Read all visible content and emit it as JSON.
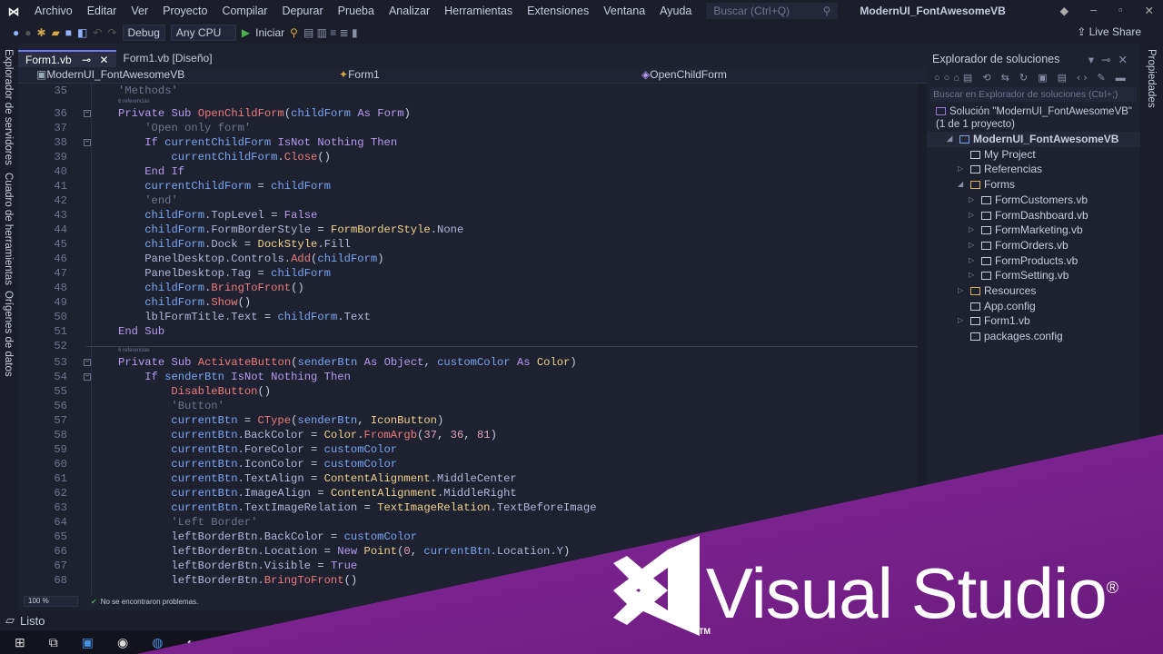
{
  "menu": {
    "logo": "VS",
    "items": [
      "Archivo",
      "Editar",
      "Ver",
      "Proyecto",
      "Compilar",
      "Depurar",
      "Prueba",
      "Analizar",
      "Herramientas",
      "Extensiones",
      "Ventana",
      "Ayuda"
    ],
    "search_placeholder": "Buscar (Ctrl+Q)",
    "window_title": "ModernUI_FontAwesomeVB"
  },
  "toolbar": {
    "config": "Debug",
    "platform": "Any CPU",
    "start": "Iniciar",
    "live_share": "Live Share"
  },
  "left_strip": [
    "Explorador de servidores",
    "Cuadro de herramientas",
    "Orígenes de datos"
  ],
  "tabs": [
    {
      "label": "Form1.vb",
      "active": true
    },
    {
      "label": "Form1.vb [Diseño]",
      "active": false
    }
  ],
  "navbar": {
    "project": "ModernUI_FontAwesomeVB",
    "class": "Form1",
    "member": "OpenChildForm"
  },
  "code": [
    {
      "n": 35,
      "i": 0,
      "t": [
        [
          "c",
          "'Methods'"
        ]
      ]
    },
    {
      "lens": "6 referencias"
    },
    {
      "n": 36,
      "i": 0,
      "fold": true,
      "t": [
        [
          "k",
          "Private Sub "
        ],
        [
          "f",
          "OpenChildForm"
        ],
        [
          "p",
          "("
        ],
        [
          "v",
          "childForm"
        ],
        [
          "k",
          " As Form"
        ],
        [
          "p",
          ")"
        ]
      ]
    },
    {
      "n": 37,
      "i": 1,
      "t": [
        [
          "c",
          "'Open only form'"
        ]
      ]
    },
    {
      "n": 38,
      "i": 1,
      "fold": true,
      "t": [
        [
          "k",
          "If "
        ],
        [
          "v",
          "currentChildForm"
        ],
        [
          "k",
          " IsNot Nothing Then"
        ]
      ]
    },
    {
      "n": 39,
      "i": 2,
      "t": [
        [
          "v",
          "currentChildForm"
        ],
        [
          "p",
          "."
        ],
        [
          "f",
          "Close"
        ],
        [
          "p",
          "()"
        ]
      ]
    },
    {
      "n": 40,
      "i": 1,
      "t": [
        [
          "k",
          "End If"
        ]
      ]
    },
    {
      "n": 41,
      "i": 1,
      "t": [
        [
          "v",
          "currentChildForm"
        ],
        [
          "p",
          " = "
        ],
        [
          "v",
          "childForm"
        ]
      ]
    },
    {
      "n": 42,
      "i": 1,
      "t": [
        [
          "c",
          "'end'"
        ]
      ]
    },
    {
      "n": 43,
      "i": 1,
      "t": [
        [
          "v",
          "childForm"
        ],
        [
          "m",
          ".TopLevel"
        ],
        [
          "p",
          " = "
        ],
        [
          "k",
          "False"
        ]
      ]
    },
    {
      "n": 44,
      "i": 1,
      "t": [
        [
          "v",
          "childForm"
        ],
        [
          "m",
          ".FormBorderStyle"
        ],
        [
          "p",
          " = "
        ],
        [
          "t",
          "FormBorderStyle"
        ],
        [
          "m",
          ".None"
        ]
      ]
    },
    {
      "n": 45,
      "i": 1,
      "t": [
        [
          "v",
          "childForm"
        ],
        [
          "m",
          ".Dock"
        ],
        [
          "p",
          " = "
        ],
        [
          "t",
          "DockStyle"
        ],
        [
          "m",
          ".Fill"
        ]
      ]
    },
    {
      "n": 46,
      "i": 1,
      "t": [
        [
          "m",
          "PanelDesktop.Controls."
        ],
        [
          "f",
          "Add"
        ],
        [
          "p",
          "("
        ],
        [
          "v",
          "childForm"
        ],
        [
          "p",
          ")"
        ]
      ]
    },
    {
      "n": 47,
      "i": 1,
      "t": [
        [
          "m",
          "PanelDesktop.Tag"
        ],
        [
          "p",
          " = "
        ],
        [
          "v",
          "childForm"
        ]
      ]
    },
    {
      "n": 48,
      "i": 1,
      "t": [
        [
          "v",
          "childForm"
        ],
        [
          "p",
          "."
        ],
        [
          "f",
          "BringToFront"
        ],
        [
          "p",
          "()"
        ]
      ]
    },
    {
      "n": 49,
      "i": 1,
      "t": [
        [
          "v",
          "childForm"
        ],
        [
          "p",
          "."
        ],
        [
          "f",
          "Show"
        ],
        [
          "p",
          "()"
        ]
      ]
    },
    {
      "n": 50,
      "i": 1,
      "t": [
        [
          "m",
          "lblFormTitle.Text"
        ],
        [
          "p",
          " = "
        ],
        [
          "v",
          "childForm"
        ],
        [
          "m",
          ".Text"
        ]
      ]
    },
    {
      "n": 51,
      "i": 0,
      "t": [
        [
          "k",
          "End Sub"
        ]
      ]
    },
    {
      "n": 52,
      "i": 0,
      "sep": true,
      "t": []
    },
    {
      "lens": "6 referencias"
    },
    {
      "n": 53,
      "i": 0,
      "fold": true,
      "t": [
        [
          "k",
          "Private Sub "
        ],
        [
          "f",
          "ActivateButton"
        ],
        [
          "p",
          "("
        ],
        [
          "v",
          "senderBtn"
        ],
        [
          "k",
          " As Object"
        ],
        [
          "p",
          ", "
        ],
        [
          "v",
          "customColor"
        ],
        [
          "k",
          " As "
        ],
        [
          "t",
          "Color"
        ],
        [
          "p",
          ")"
        ]
      ]
    },
    {
      "n": 54,
      "i": 1,
      "fold": true,
      "t": [
        [
          "k",
          "If "
        ],
        [
          "v",
          "senderBtn"
        ],
        [
          "k",
          " IsNot Nothing Then"
        ]
      ]
    },
    {
      "n": 55,
      "i": 2,
      "t": [
        [
          "f",
          "DisableButton"
        ],
        [
          "p",
          "()"
        ]
      ]
    },
    {
      "n": 56,
      "i": 2,
      "t": [
        [
          "c",
          "'Button'"
        ]
      ]
    },
    {
      "n": 57,
      "i": 2,
      "t": [
        [
          "v",
          "currentBtn"
        ],
        [
          "p",
          " = "
        ],
        [
          "f",
          "CType"
        ],
        [
          "p",
          "("
        ],
        [
          "v",
          "senderBtn"
        ],
        [
          "p",
          ", "
        ],
        [
          "t",
          "IconButton"
        ],
        [
          "p",
          ")"
        ]
      ]
    },
    {
      "n": 58,
      "i": 2,
      "t": [
        [
          "v",
          "currentBtn"
        ],
        [
          "m",
          ".BackColor"
        ],
        [
          "p",
          " = "
        ],
        [
          "t",
          "Color"
        ],
        [
          "p",
          "."
        ],
        [
          "f",
          "FromArgb"
        ],
        [
          "p",
          "("
        ],
        [
          "n",
          "37"
        ],
        [
          "p",
          ", "
        ],
        [
          "n",
          "36"
        ],
        [
          "p",
          ", "
        ],
        [
          "n",
          "81"
        ],
        [
          "p",
          ")"
        ]
      ]
    },
    {
      "n": 59,
      "i": 2,
      "t": [
        [
          "v",
          "currentBtn"
        ],
        [
          "m",
          ".ForeColor"
        ],
        [
          "p",
          " = "
        ],
        [
          "v",
          "customColor"
        ]
      ]
    },
    {
      "n": 60,
      "i": 2,
      "t": [
        [
          "v",
          "currentBtn"
        ],
        [
          "m",
          ".IconColor"
        ],
        [
          "p",
          " = "
        ],
        [
          "v",
          "customColor"
        ]
      ]
    },
    {
      "n": 61,
      "i": 2,
      "t": [
        [
          "v",
          "currentBtn"
        ],
        [
          "m",
          ".TextAlign"
        ],
        [
          "p",
          " = "
        ],
        [
          "t",
          "ContentAlignment"
        ],
        [
          "m",
          ".MiddleCenter"
        ]
      ]
    },
    {
      "n": 62,
      "i": 2,
      "t": [
        [
          "v",
          "currentBtn"
        ],
        [
          "m",
          ".ImageAlign"
        ],
        [
          "p",
          " = "
        ],
        [
          "t",
          "ContentAlignment"
        ],
        [
          "m",
          ".MiddleRight"
        ]
      ]
    },
    {
      "n": 63,
      "i": 2,
      "t": [
        [
          "v",
          "currentBtn"
        ],
        [
          "m",
          ".TextImageRelation"
        ],
        [
          "p",
          " = "
        ],
        [
          "t",
          "TextImageRelation"
        ],
        [
          "m",
          ".TextBeforeImage"
        ]
      ]
    },
    {
      "n": 64,
      "i": 2,
      "t": [
        [
          "c",
          "'Left Border'"
        ]
      ]
    },
    {
      "n": 65,
      "i": 2,
      "t": [
        [
          "m",
          "leftBorderBtn.BackColor"
        ],
        [
          "p",
          " = "
        ],
        [
          "v",
          "customColor"
        ]
      ]
    },
    {
      "n": 66,
      "i": 2,
      "t": [
        [
          "m",
          "leftBorderBtn.Location"
        ],
        [
          "p",
          " = "
        ],
        [
          "k",
          "New "
        ],
        [
          "t",
          "Point"
        ],
        [
          "p",
          "("
        ],
        [
          "n",
          "0"
        ],
        [
          "p",
          ", "
        ],
        [
          "v",
          "currentBtn"
        ],
        [
          "m",
          ".Location.Y"
        ],
        [
          "p",
          ")"
        ]
      ]
    },
    {
      "n": 67,
      "i": 2,
      "t": [
        [
          "m",
          "leftBorderBtn.Visible"
        ],
        [
          "p",
          " = "
        ],
        [
          "k",
          "True"
        ]
      ]
    },
    {
      "n": 68,
      "i": 2,
      "t": [
        [
          "m",
          "leftBorderBtn."
        ],
        [
          "f",
          "BringToFront"
        ],
        [
          "p",
          "()"
        ]
      ]
    }
  ],
  "editor_status": {
    "zoom": "100 %",
    "problems": "No se encontraron problemas."
  },
  "status": {
    "text": "Listo"
  },
  "solution_explorer": {
    "title": "Explorador de soluciones",
    "search_placeholder": "Buscar en Explorador de soluciones (Ctrl+;)",
    "nodes": [
      {
        "label": "Solución \"ModernUI_FontAwesomeVB\" (1 de 1 proyecto)",
        "depth": 0,
        "arrow": "",
        "icon": "solution-icon"
      },
      {
        "label": "ModernUI_FontAwesomeVB",
        "depth": 1,
        "arrow": "◢",
        "icon": "vb-project-icon",
        "bold": true
      },
      {
        "label": "My Project",
        "depth": 2,
        "arrow": "",
        "icon": "wrench-icon"
      },
      {
        "label": "Referencias",
        "depth": 2,
        "arrow": "▷",
        "icon": "references-icon"
      },
      {
        "label": "Forms",
        "depth": 2,
        "arrow": "◢",
        "icon": "folder-open-icon"
      },
      {
        "label": "FormCustomers.vb",
        "depth": 3,
        "arrow": "▷",
        "icon": "form-icon"
      },
      {
        "label": "FormDashboard.vb",
        "depth": 3,
        "arrow": "▷",
        "icon": "form-icon"
      },
      {
        "label": "FormMarketing.vb",
        "depth": 3,
        "arrow": "▷",
        "icon": "form-icon"
      },
      {
        "label": "FormOrders.vb",
        "depth": 3,
        "arrow": "▷",
        "icon": "form-icon"
      },
      {
        "label": "FormProducts.vb",
        "depth": 3,
        "arrow": "▷",
        "icon": "form-icon"
      },
      {
        "label": "FormSetting.vb",
        "depth": 3,
        "arrow": "▷",
        "icon": "form-icon"
      },
      {
        "label": "Resources",
        "depth": 2,
        "arrow": "▷",
        "icon": "folder-icon"
      },
      {
        "label": "App.config",
        "depth": 2,
        "arrow": "",
        "icon": "config-icon"
      },
      {
        "label": "Form1.vb",
        "depth": 2,
        "arrow": "▷",
        "icon": "form-icon"
      },
      {
        "label": "packages.config",
        "depth": 2,
        "arrow": "",
        "icon": "config-icon"
      }
    ]
  },
  "properties_strip": "Propiedades",
  "banner": {
    "text": "Visual Studio",
    "tm": "TM",
    "reg": "®",
    "color": "#7a1f8c"
  }
}
